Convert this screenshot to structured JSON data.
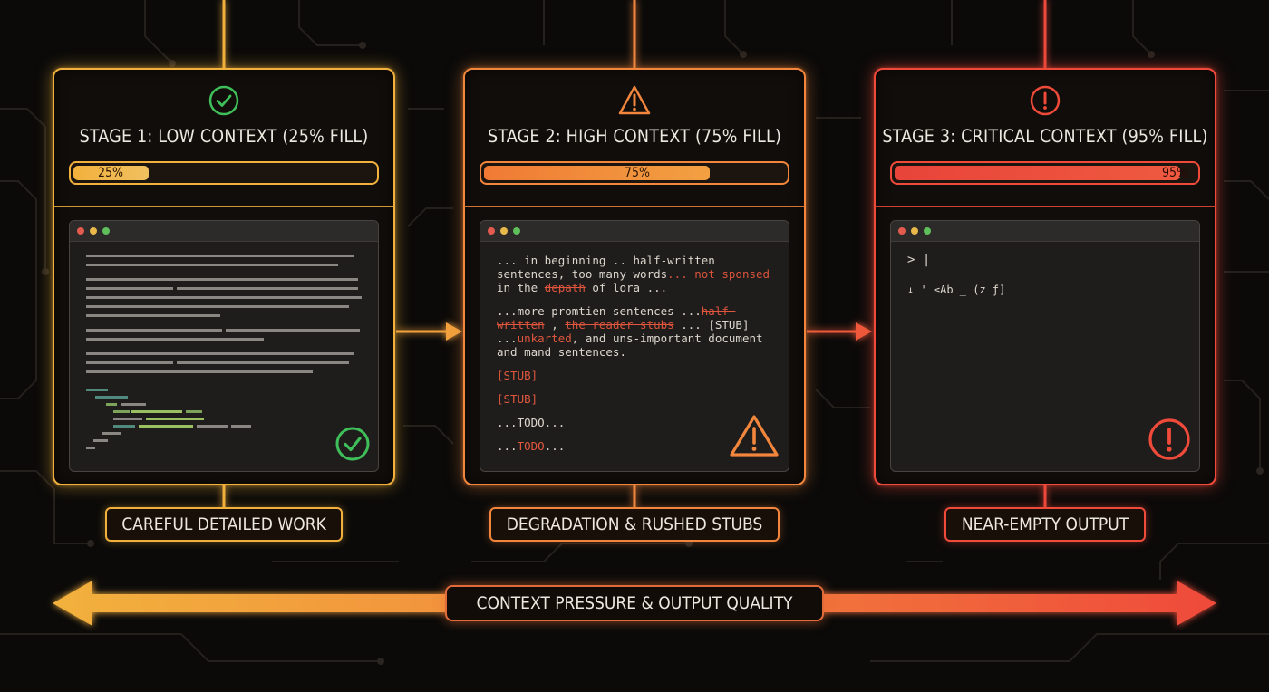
{
  "colors": {
    "stage1": "#f2b13c",
    "stage2": "#f2863c",
    "stage3": "#ef4a3a",
    "ok": "#3fbf5a"
  },
  "stages": [
    {
      "title": "STAGE 1: LOW CONTEXT (25% FILL)",
      "fill_percent": 25,
      "fill_label": "25%",
      "status_icon": "check-circle-icon",
      "caption": "CAREFUL DETAILED WORK"
    },
    {
      "title": "STAGE 2: HIGH CONTEXT (75% FILL)",
      "fill_percent": 75,
      "fill_label": "75%",
      "status_icon": "warning-triangle-icon",
      "caption": "DEGRADATION & RUSHED STUBS",
      "code": {
        "l1a": "... in beginning .. half-written",
        "l1b": "sentences, too many words",
        "l1c": "... not sponsed",
        "l1d": "in the ",
        "l1e": "depath",
        "l1f": " of lora ...",
        "l2a": "...more promtien sentences ...",
        "l2b": "half-",
        "l2c": "written",
        "l2d": " , ",
        "l2e": "the reader stubs",
        "l2f": " ... [STUB]",
        "l2g": "...",
        "l2h": "unkarted",
        "l2i": ", and uns-important document",
        "l2j": "and mand sentences.",
        "s1": "[STUB]",
        "s2": "[STUB]",
        "t1": "...TODO...",
        "t2a": "...",
        "t2b": "TODO",
        "t2c": "..."
      }
    },
    {
      "title": "STAGE 3: CRITICAL CONTEXT (95% FILL)",
      "fill_percent": 95,
      "fill_label": "95%",
      "status_icon": "exclamation-circle-icon",
      "caption": "NEAR-EMPTY OUTPUT",
      "code": {
        "prompt": "> |",
        "garbled": "↓ ' ≤Ab _ (z ƒ]"
      }
    }
  ],
  "axis_label": "CONTEXT PRESSURE & OUTPUT QUALITY"
}
